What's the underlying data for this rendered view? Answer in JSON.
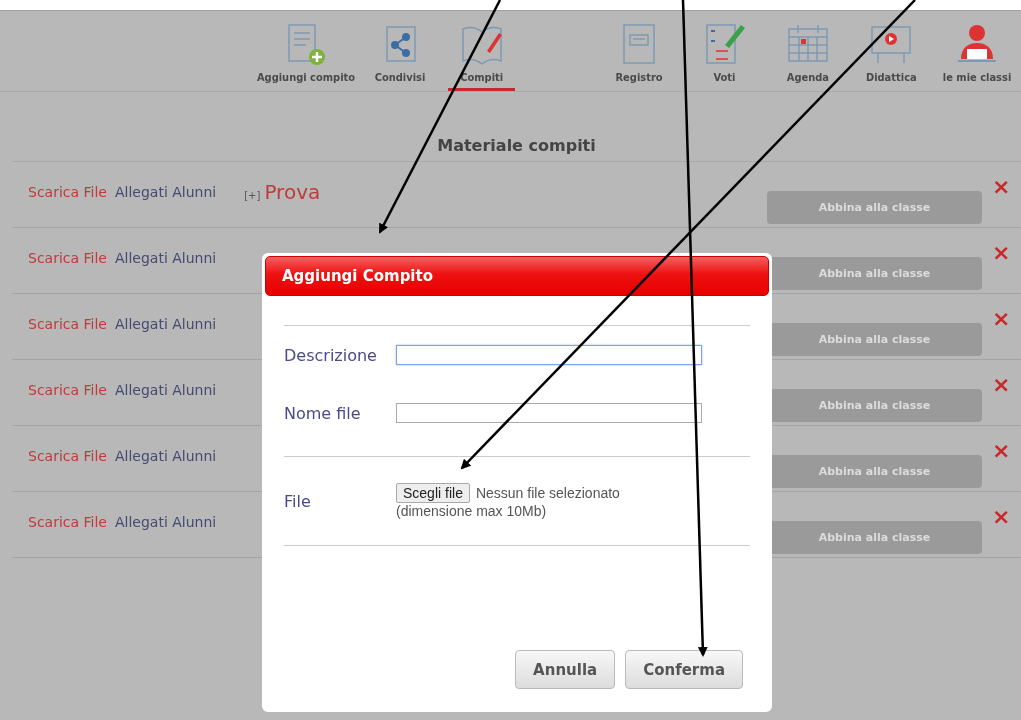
{
  "toolbar": {
    "items": [
      {
        "label": "Aggiungi compito",
        "kind": "add",
        "selected": false
      },
      {
        "label": "Condivisi",
        "kind": "share",
        "selected": false
      },
      {
        "label": "Compiti",
        "kind": "book",
        "selected": true
      },
      {
        "label": "Registro",
        "kind": "register",
        "selected": false
      },
      {
        "label": "Voti",
        "kind": "grades",
        "selected": false
      },
      {
        "label": "Agenda",
        "kind": "calendar",
        "selected": false
      },
      {
        "label": "Didattica",
        "kind": "board",
        "selected": false
      },
      {
        "label": "le mie classi",
        "kind": "person",
        "selected": false
      }
    ]
  },
  "heading": "Materiale compiti",
  "rows": [
    {
      "download": "Scarica File",
      "attachments": "Allegati Alunni",
      "toggle": "[+]",
      "title": "Prova",
      "action": "Abbina alla classe",
      "disabled": true,
      "delete": "×"
    },
    {
      "download": "Scarica File",
      "attachments": "Allegati Alunni",
      "action": "Abbina alla classe",
      "disabled": true,
      "delete": "×"
    },
    {
      "download": "Scarica File",
      "attachments": "Allegati Alunni",
      "action": "Abbina alla classe",
      "disabled": true,
      "delete": "×"
    },
    {
      "download": "Scarica File",
      "attachments": "Allegati Alunni",
      "action": "Abbina alla classe",
      "disabled": true,
      "delete": "×"
    },
    {
      "download": "Scarica File",
      "attachments": "Allegati Alunni",
      "action": "Abbina alla classe",
      "disabled": true,
      "delete": "×"
    },
    {
      "download": "Scarica File",
      "attachments": "Allegati Alunni",
      "action": "Abbina alla classe",
      "disabled": true,
      "delete": "×"
    }
  ],
  "dialog": {
    "title": "Aggiungi Compito",
    "fields": [
      {
        "label": "Descrizione",
        "focused": true
      },
      {
        "label": "Nome file",
        "focused": false
      }
    ],
    "file": {
      "label": "File",
      "button": "Scegli file",
      "status": "Nessun file selezionato",
      "hint": "(dimensione max 10Mb)"
    },
    "buttons": [
      "Annulla",
      "Conferma"
    ]
  }
}
